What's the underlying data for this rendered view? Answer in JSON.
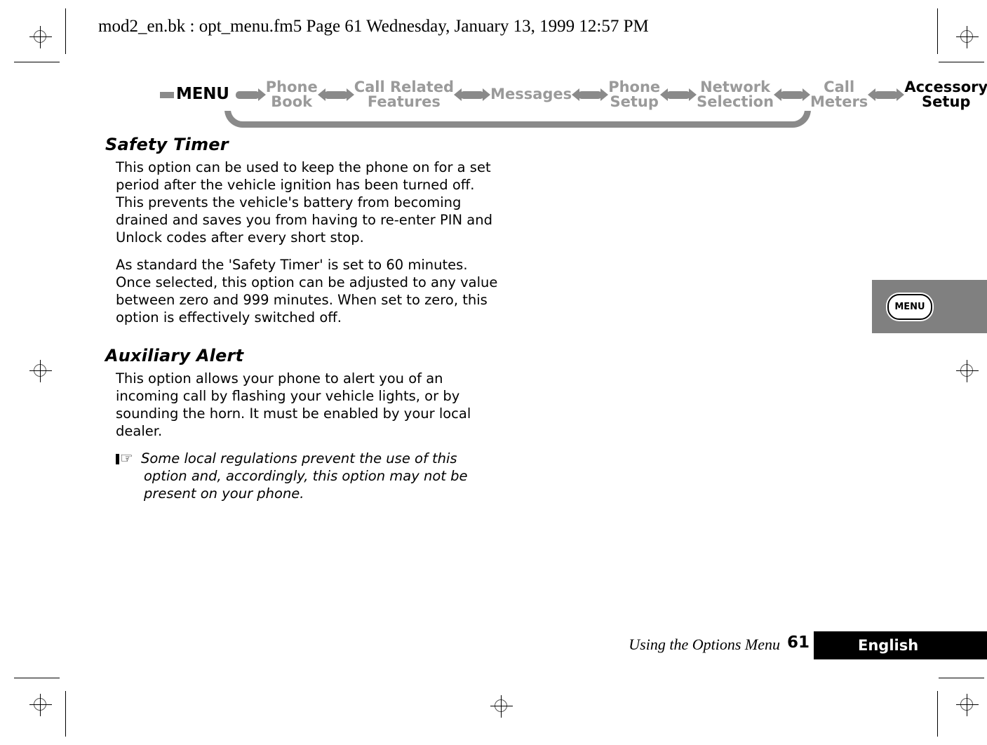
{
  "header": {
    "file_line": "mod2_en.bk : opt_menu.fm5  Page 61  Wednesday, January 13, 1999  12:57 PM"
  },
  "nav": {
    "root_label": "MENU",
    "items": [
      {
        "label_line1": "Phone",
        "label_line2": "Book",
        "active": false
      },
      {
        "label_line1": "Call Related",
        "label_line2": "Features",
        "active": false
      },
      {
        "label_line1": "Messages",
        "label_line2": "",
        "active": false
      },
      {
        "label_line1": "Phone",
        "label_line2": "Setup",
        "active": false
      },
      {
        "label_line1": "Network",
        "label_line2": "Selection",
        "active": false
      },
      {
        "label_line1": "Call",
        "label_line2": "Meters",
        "active": false
      },
      {
        "label_line1": "Accessory",
        "label_line2": "Setup",
        "active": true
      }
    ]
  },
  "sections": [
    {
      "heading": "Safety Timer",
      "paragraphs": [
        "This option can be used to keep the phone on for a set period after the vehicle ignition has been turned off. This prevents the vehicle's battery from becoming drained and saves you from having to re-enter PIN and Unlock codes after every short stop.",
        "As standard the 'Safety Timer' is set to 60 minutes. Once selected, this option can be adjusted to any value between zero and 999 minutes. When set to zero, this option is effectively switched off."
      ]
    },
    {
      "heading": "Auxiliary Alert",
      "paragraphs": [
        "This option allows your phone to alert you of an incoming call by flashing your vehicle lights, or by sounding the horn. It must be enabled by your local dealer."
      ],
      "note": {
        "icon": "pointing-hand-icon",
        "glyph": "☞",
        "text": "Some local regulations prevent the use of this option and, accordingly, this option may not be present on your phone."
      }
    }
  ],
  "side_tab": {
    "label": "MENU"
  },
  "footer": {
    "title": "Using the Options Menu",
    "page_number": "61",
    "language": "English"
  },
  "colors": {
    "nav_gray": "#8a8a8a",
    "nav_text_gray": "#9a9a9a",
    "tab_gray": "#808080",
    "black": "#000000",
    "white": "#ffffff"
  }
}
